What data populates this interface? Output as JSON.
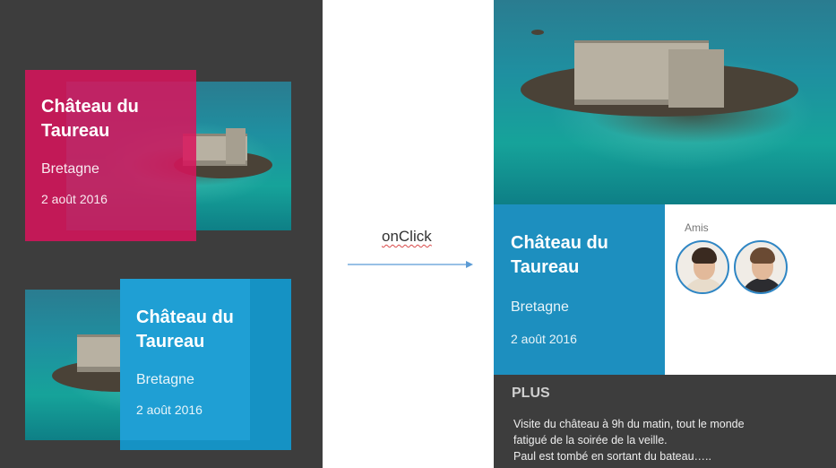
{
  "cards": [
    {
      "title_line1": "Château du",
      "title_line2": "Taureau",
      "region": "Bretagne",
      "date": "2 août 2016",
      "accent": "#d8145c"
    },
    {
      "title_line1": "Château du",
      "title_line2": "Taureau",
      "region": "Bretagne",
      "date": "2 août 2016",
      "accent": "#1592c4"
    }
  ],
  "transition": {
    "label": "onClick",
    "arrow_icon": "arrow-right-icon"
  },
  "detail": {
    "title_line1": "Château du",
    "title_line2": "Taureau",
    "region": "Bretagne",
    "date": "2 août 2016",
    "accent": "#1d8fbf",
    "friends": {
      "label": "Amis",
      "avatars": [
        "avatar-man-beard",
        "avatar-man-suit"
      ]
    },
    "more": {
      "title": "PLUS",
      "lines": [
        "Visite du château à 9h du matin,  tout le monde",
        "fatigué  de la soirée de la veille.",
        "Paul est tombé  en sortant du bateau….."
      ]
    }
  }
}
